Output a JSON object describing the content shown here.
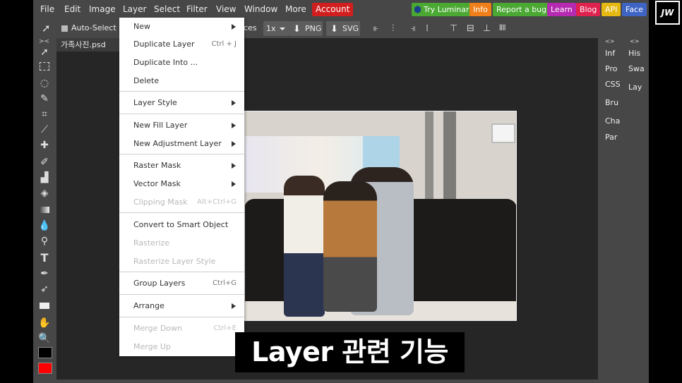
{
  "menubar": {
    "items": [
      "File",
      "Edit",
      "Image",
      "Layer",
      "Select",
      "Filter",
      "View",
      "Window",
      "More"
    ],
    "account": "Account",
    "pills": [
      "Try Luminar",
      "Info",
      "Report a bug",
      "Learn",
      "Blog",
      "API",
      "Face"
    ],
    "pill_colors": [
      "#4aa833",
      "#f07f1a",
      "#4aa833",
      "#b52ab0",
      "#e0224f",
      "#e5b812",
      "#3e64c4"
    ]
  },
  "toolbar": {
    "auto_select": "Auto-Select",
    "ces_fragment": "ces",
    "zoom": "1x",
    "png": "PNG",
    "svg": "SVG"
  },
  "document": {
    "tab_name": "가족사진.psd",
    "close": "×"
  },
  "right_panels": {
    "left_col": [
      "Inf",
      "Pro",
      "CSS",
      "Bru",
      "Cha",
      "Par"
    ],
    "right_col": [
      "His",
      "Swa",
      "Lay"
    ],
    "collapse": "<>"
  },
  "layer_menu": {
    "items": [
      {
        "label": "New",
        "shortcut": "",
        "submenu": true,
        "disabled": false
      },
      {
        "label": "Duplicate Layer",
        "shortcut": "Ctrl + J",
        "submenu": false,
        "disabled": false
      },
      {
        "label": "Duplicate Into ...",
        "shortcut": "",
        "submenu": false,
        "disabled": false
      },
      {
        "label": "Delete",
        "shortcut": "",
        "submenu": false,
        "disabled": false
      },
      {
        "label": "Layer Style",
        "shortcut": "",
        "submenu": true,
        "disabled": false
      },
      {
        "label": "New Fill Layer",
        "shortcut": "",
        "submenu": true,
        "disabled": false
      },
      {
        "label": "New Adjustment Layer",
        "shortcut": "",
        "submenu": true,
        "disabled": false
      },
      {
        "label": "Raster Mask",
        "shortcut": "",
        "submenu": true,
        "disabled": false
      },
      {
        "label": "Vector Mask",
        "shortcut": "",
        "submenu": true,
        "disabled": false
      },
      {
        "label": "Clipping Mask",
        "shortcut": "Alt+Ctrl+G",
        "submenu": false,
        "disabled": true
      },
      {
        "label": "Convert to Smart Object",
        "shortcut": "",
        "submenu": false,
        "disabled": false
      },
      {
        "label": "Rasterize",
        "shortcut": "",
        "submenu": false,
        "disabled": true
      },
      {
        "label": "Rasterize Layer Style",
        "shortcut": "",
        "submenu": false,
        "disabled": true
      },
      {
        "label": "Group Layers",
        "shortcut": "Ctrl+G",
        "submenu": false,
        "disabled": false
      },
      {
        "label": "Arrange",
        "shortcut": "",
        "submenu": true,
        "disabled": false
      },
      {
        "label": "Merge Down",
        "shortcut": "Ctrl+E",
        "submenu": false,
        "disabled": true
      },
      {
        "label": "Merge Up",
        "shortcut": "",
        "submenu": false,
        "disabled": true
      }
    ]
  },
  "tools": [
    "move",
    "marquee",
    "lasso",
    "quick-select",
    "crop",
    "eyedropper",
    "healing",
    "brush",
    "stamp",
    "eraser",
    "gradient",
    "blur",
    "dodge",
    "text",
    "pen",
    "path-select",
    "shape",
    "hand",
    "zoom"
  ],
  "text_tool_glyph": "T",
  "color_swatches": {
    "foreground": "#000000",
    "background": "#ff0000"
  },
  "subtitle": "Layer 관련 기능",
  "logo_text": "JW"
}
